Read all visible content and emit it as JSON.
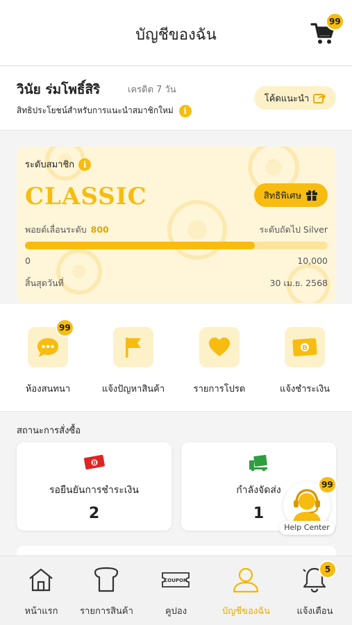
{
  "header": {
    "title": "บัญชีของฉัน",
    "cart_badge": "99"
  },
  "profile": {
    "name": "วินัย ร่มโพธิ์สิริ",
    "credit": "เครดิต 7 วัน",
    "benefit_text": "สิทธิประโยชน์สำหรับการแนะนำสมาชิกใหม่",
    "referral_label": "โค้ดแนะนำ"
  },
  "membership": {
    "level_label": "ระดับสมาชิก",
    "tier": "CLASSIC",
    "privilege_label": "สิทธิพิเศษ",
    "points_label": "พอยต์เลื่อนระดับ",
    "points_value": "800",
    "next_level_label": "ระดับถัดไป Silver",
    "progress_fraction": 0.76,
    "range_min": "0",
    "range_max": "10,000",
    "expiry_label": "สิ้นสุดวันที่",
    "expiry_date": "30 เม.ย. 2568"
  },
  "menu": [
    {
      "label": "ห้องสนทนา",
      "icon": "chat-bubble-icon",
      "badge": "99"
    },
    {
      "label": "แจ้งปัญหาสินค้า",
      "icon": "flag-icon",
      "badge": ""
    },
    {
      "label": "รายการโปรด",
      "icon": "heart-icon",
      "badge": ""
    },
    {
      "label": "แจ้งชำระเงิน",
      "icon": "banknote-icon",
      "badge": ""
    }
  ],
  "orders": {
    "title": "สถานะการสั่งซื้อ",
    "cards": [
      {
        "label": "รอยืนยันการชำระเงิน",
        "count": "2",
        "icon": "red-banknote-icon"
      },
      {
        "label": "กำลังจัดส่ง",
        "count": "1",
        "icon": "green-truck-icon"
      }
    ]
  },
  "help": {
    "label": "Help Center",
    "badge": "99"
  },
  "bottom_nav": {
    "items": [
      {
        "label": "หน้าแรก",
        "icon": "home-icon"
      },
      {
        "label": "รายการสินค้า",
        "icon": "bread-icon"
      },
      {
        "label": "คูปอง",
        "icon": "coupon-icon",
        "icon_text": "COUPON"
      },
      {
        "label": "บัญชีของฉัน",
        "icon": "user-icon",
        "active": true
      },
      {
        "label": "แจ้งเตือน",
        "icon": "bell-icon",
        "badge": "5"
      }
    ]
  },
  "colors": {
    "accent": "#f7bc0f",
    "accent_light": "#fdf1c9",
    "card_bg": "#fff6d9",
    "red": "#e02424",
    "green": "#2e9e3f"
  }
}
